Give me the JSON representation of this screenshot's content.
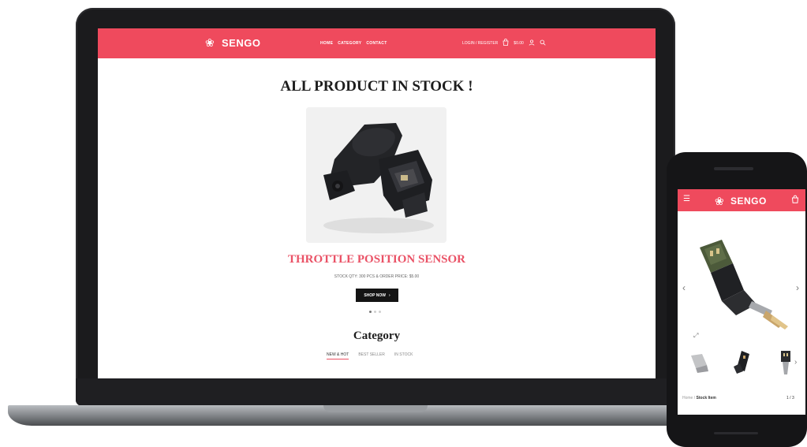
{
  "site": {
    "brand": "SENGO",
    "logo_glyph": "❀",
    "accent_color": "#ef4a5d"
  },
  "laptop": {
    "nav": {
      "home": "HOME",
      "category": "CATEGORY",
      "contact": "CONTACT"
    },
    "header_right": {
      "account": "LOGIN / REGISTER",
      "bag": "$0.00"
    },
    "hero": {
      "title": "ALL PRODUCT IN STOCK !",
      "product_name": "THROTTLE POSITION SENSOR",
      "product_sub": "STOCK QTY: 300 PCS & ORDER PRICE: $5.00",
      "shop_button": "SHOP NOW",
      "slides": 3,
      "active_slide": 1
    },
    "category": {
      "title": "Category",
      "tabs": [
        "NEW & HOT",
        "BEST SELLER",
        "IN STOCK"
      ]
    }
  },
  "phone": {
    "menu_icon": "☰",
    "bag_icon": "bag-icon",
    "breadcrumb_home": "Home",
    "breadcrumb_sep": "/",
    "breadcrumb_current": "Stock Item",
    "counter": "1 / 3"
  },
  "icons": {
    "user": "user-icon",
    "bag": "bag-icon",
    "search": "search-icon",
    "chevron_right": "chevron-right-icon",
    "chevron_left": "chevron-left-icon",
    "zoom": "zoom-icon"
  }
}
